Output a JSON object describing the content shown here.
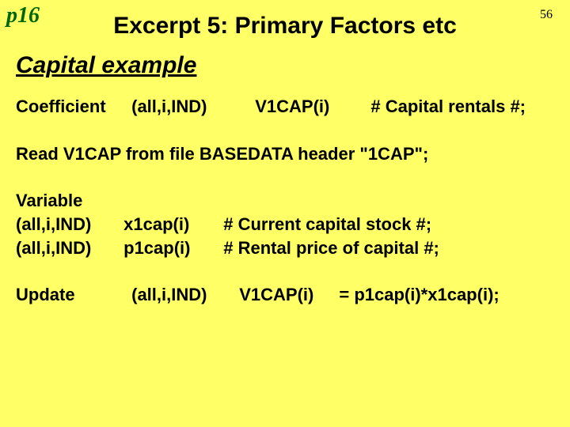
{
  "page_ref": "p16",
  "slide_number": "56",
  "title": "Excerpt 5: Primary Factors etc",
  "subtitle": "Capital example",
  "coeff": {
    "label": "Coefficient",
    "domain": "(all,i,IND)",
    "name": "V1CAP(i)",
    "comment": "# Capital rentals #;"
  },
  "read_line": "Read V1CAP from file BASEDATA header \"1CAP\";",
  "variable": {
    "label": "Variable",
    "rows": [
      {
        "domain": "(all,i,IND)",
        "name": "x1cap(i)",
        "comment": "# Current capital stock #;"
      },
      {
        "domain": "(all,i,IND)",
        "name": "p1cap(i)",
        "comment": "# Rental price of capital #;"
      }
    ]
  },
  "update": {
    "label": "Update",
    "domain": "(all,i,IND)",
    "name": "V1CAP(i)",
    "rhs": "= p1cap(i)*x1cap(i);"
  }
}
